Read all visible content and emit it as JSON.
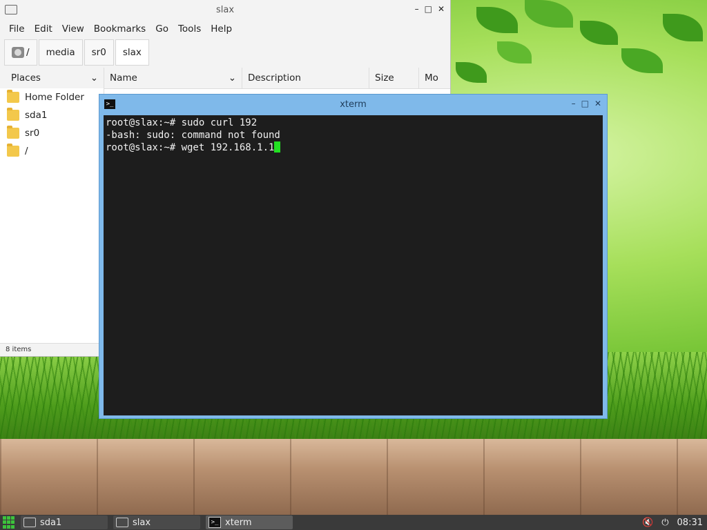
{
  "file_manager": {
    "title": "slax",
    "menu": [
      "File",
      "Edit",
      "View",
      "Bookmarks",
      "Go",
      "Tools",
      "Help"
    ],
    "breadcrumbs": [
      "/",
      "media",
      "sr0",
      "slax"
    ],
    "places_header": "Places",
    "places": [
      "Home Folder",
      "sda1",
      "sr0",
      "/"
    ],
    "columns": [
      "Name",
      "Description",
      "Size",
      "Mo"
    ],
    "status": "8 items"
  },
  "xterm": {
    "title": "xterm",
    "lines": [
      "root@slax:~# sudo curl 192",
      "-bash: sudo: command not found",
      "root@slax:~# wget 192.168.1.1"
    ],
    "cursor_color": "#22e022"
  },
  "taskbar": {
    "tasks": [
      "sda1",
      "slax",
      "xterm"
    ],
    "active_task": "xterm",
    "clock": "08:31"
  },
  "window_controls": {
    "minimize": "–",
    "maximize": "□",
    "close": "✕"
  }
}
